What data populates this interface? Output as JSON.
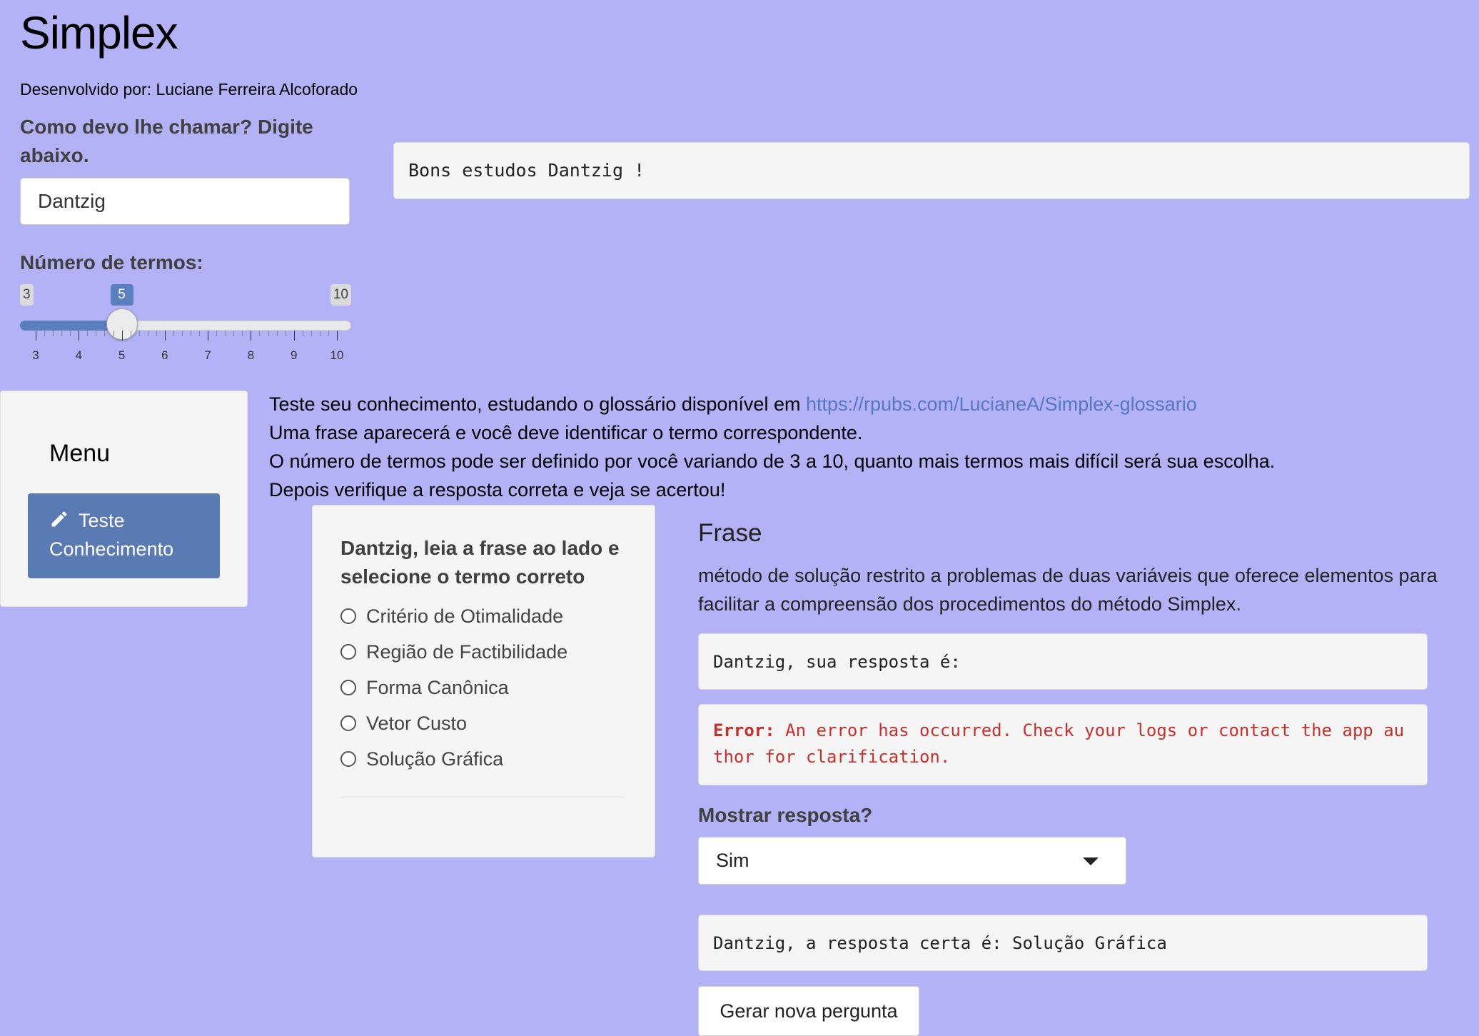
{
  "header": {
    "title": "Simplex",
    "author": "Desenvolvido por: Luciane Ferreira Alcoforado"
  },
  "name_input": {
    "label": "Como devo lhe chamar? Digite abaixo.",
    "value": "Dantzig"
  },
  "greeting": "Bons estudos Dantzig !",
  "slider": {
    "label": "Número de termos:",
    "min": 3,
    "max": 10,
    "value": 5,
    "min_label": "3",
    "max_label": "10",
    "value_label": "5",
    "ticks": [
      "3",
      "4",
      "5",
      "6",
      "7",
      "8",
      "9",
      "10"
    ]
  },
  "sidebar": {
    "title": "Menu",
    "button_label": "Teste Conhecimento",
    "button_icon": "pencil-icon"
  },
  "intro": {
    "line1_prefix": "Teste seu conhecimento, estudando o glossário disponível em ",
    "link": "https://rpubs.com/LucianeA/Simplex-glossario",
    "line2": "Uma frase aparecerá e você deve identificar o termo correspondente.",
    "line3": "O número de termos pode ser definido por você variando de 3 a 10, quanto mais termos mais difícil será sua escolha.",
    "line4": "Depois verifique a resposta correta e veja se acertou!"
  },
  "quiz": {
    "question": "Dantzig, leia a frase ao lado e selecione o termo correto",
    "options": [
      "Critério de Otimalidade",
      "Região de Factibilidade",
      "Forma Canônica",
      "Vetor Custo",
      "Solução Gráfica"
    ]
  },
  "frase": {
    "heading": "Frase",
    "text": "método de solução restrito a problemas de duas variáveis que oferece elementos para facilitar a compreensão dos procedimentos do método Simplex."
  },
  "answer": "Dantzig, sua resposta é:",
  "error": {
    "prefix": "Error:",
    "message": " An error has occurred. Check your logs or contact the app author for clarification."
  },
  "show_answer": {
    "label": "Mostrar resposta?",
    "selected": "Sim"
  },
  "correct_answer": "Dantzig, a resposta certa é: Solução Gráfica",
  "new_question_button": "Gerar nova pergunta",
  "colors": {
    "background": "#b4b2f6",
    "accent": "#5a7ab4",
    "error": "#c9302c",
    "link": "#5577c6"
  }
}
